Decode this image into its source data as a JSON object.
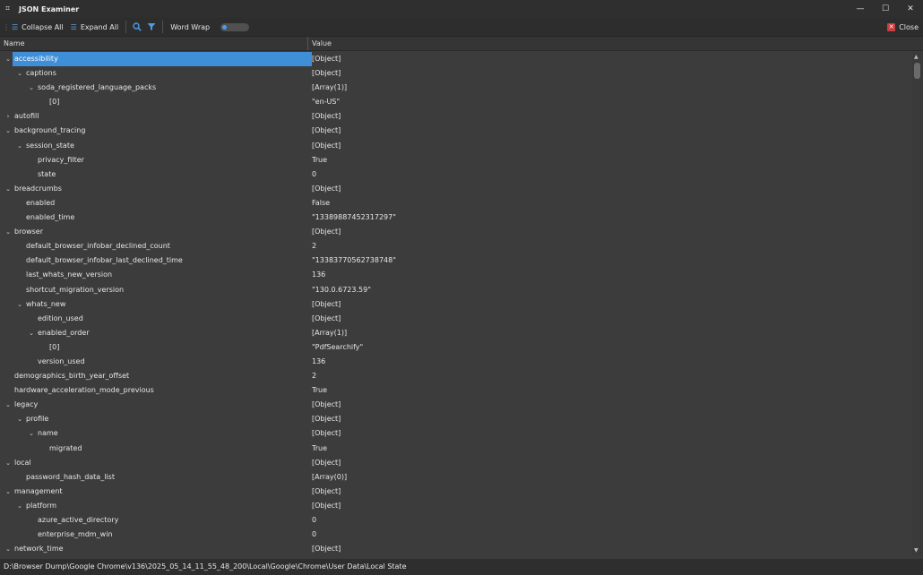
{
  "window": {
    "title": "JSON Examiner",
    "minimize_glyph": "—",
    "maximize_glyph": "☐",
    "close_glyph": "✕"
  },
  "toolbar": {
    "collapse_all": "Collapse All",
    "expand_all": "Expand All",
    "search_icon": "search-icon",
    "filter_icon": "filter-icon",
    "word_wrap": "Word Wrap",
    "word_wrap_on": false,
    "close": "Close"
  },
  "columns": {
    "name": "Name",
    "value": "Value"
  },
  "rows": [
    {
      "name": "accessibility",
      "value": "[Object]",
      "depth": 0,
      "toggle": "expanded",
      "selected": true
    },
    {
      "name": "captions",
      "value": "[Object]",
      "depth": 1,
      "toggle": "expanded"
    },
    {
      "name": "soda_registered_language_packs",
      "value": "[Array(1)]",
      "depth": 2,
      "toggle": "expanded"
    },
    {
      "name": "[0]",
      "value": "\"en-US\"",
      "depth": 3,
      "toggle": "none"
    },
    {
      "name": "autofill",
      "value": "[Object]",
      "depth": 0,
      "toggle": "collapsed"
    },
    {
      "name": "background_tracing",
      "value": "[Object]",
      "depth": 0,
      "toggle": "expanded"
    },
    {
      "name": "session_state",
      "value": "[Object]",
      "depth": 1,
      "toggle": "expanded"
    },
    {
      "name": "privacy_filter",
      "value": "True",
      "depth": 2,
      "toggle": "none"
    },
    {
      "name": "state",
      "value": "0",
      "depth": 2,
      "toggle": "none"
    },
    {
      "name": "breadcrumbs",
      "value": "[Object]",
      "depth": 0,
      "toggle": "expanded"
    },
    {
      "name": "enabled",
      "value": "False",
      "depth": 1,
      "toggle": "none"
    },
    {
      "name": "enabled_time",
      "value": "\"13389887452317297\"",
      "depth": 1,
      "toggle": "none"
    },
    {
      "name": "browser",
      "value": "[Object]",
      "depth": 0,
      "toggle": "expanded"
    },
    {
      "name": "default_browser_infobar_declined_count",
      "value": "2",
      "depth": 1,
      "toggle": "none"
    },
    {
      "name": "default_browser_infobar_last_declined_time",
      "value": "\"13383770562738748\"",
      "depth": 1,
      "toggle": "none"
    },
    {
      "name": "last_whats_new_version",
      "value": "136",
      "depth": 1,
      "toggle": "none"
    },
    {
      "name": "shortcut_migration_version",
      "value": "\"130.0.6723.59\"",
      "depth": 1,
      "toggle": "none"
    },
    {
      "name": "whats_new",
      "value": "[Object]",
      "depth": 1,
      "toggle": "expanded"
    },
    {
      "name": "edition_used",
      "value": "[Object]",
      "depth": 2,
      "toggle": "none"
    },
    {
      "name": "enabled_order",
      "value": "[Array(1)]",
      "depth": 2,
      "toggle": "expanded"
    },
    {
      "name": "[0]",
      "value": "\"PdfSearchify\"",
      "depth": 3,
      "toggle": "none"
    },
    {
      "name": "version_used",
      "value": "136",
      "depth": 2,
      "toggle": "none"
    },
    {
      "name": "demographics_birth_year_offset",
      "value": "2",
      "depth": 0,
      "toggle": "none"
    },
    {
      "name": "hardware_acceleration_mode_previous",
      "value": "True",
      "depth": 0,
      "toggle": "none"
    },
    {
      "name": "legacy",
      "value": "[Object]",
      "depth": 0,
      "toggle": "expanded"
    },
    {
      "name": "profile",
      "value": "[Object]",
      "depth": 1,
      "toggle": "expanded"
    },
    {
      "name": "name",
      "value": "[Object]",
      "depth": 2,
      "toggle": "expanded"
    },
    {
      "name": "migrated",
      "value": "True",
      "depth": 3,
      "toggle": "none"
    },
    {
      "name": "local",
      "value": "[Object]",
      "depth": 0,
      "toggle": "expanded"
    },
    {
      "name": "password_hash_data_list",
      "value": "[Array(0)]",
      "depth": 1,
      "toggle": "none"
    },
    {
      "name": "management",
      "value": "[Object]",
      "depth": 0,
      "toggle": "expanded"
    },
    {
      "name": "platform",
      "value": "[Object]",
      "depth": 1,
      "toggle": "expanded"
    },
    {
      "name": "azure_active_directory",
      "value": "0",
      "depth": 2,
      "toggle": "none"
    },
    {
      "name": "enterprise_mdm_win",
      "value": "0",
      "depth": 2,
      "toggle": "none"
    },
    {
      "name": "network_time",
      "value": "[Object]",
      "depth": 0,
      "toggle": "expanded"
    }
  ],
  "status": {
    "path": "D:\\Browser Dump\\Google Chrome\\v136\\2025_05_14_11_55_48_200\\Local\\Google\\Chrome\\User Data\\Local State"
  },
  "colors": {
    "selection": "#3f8fd8",
    "accent": "#4a9de8",
    "close_red": "#c94040"
  }
}
